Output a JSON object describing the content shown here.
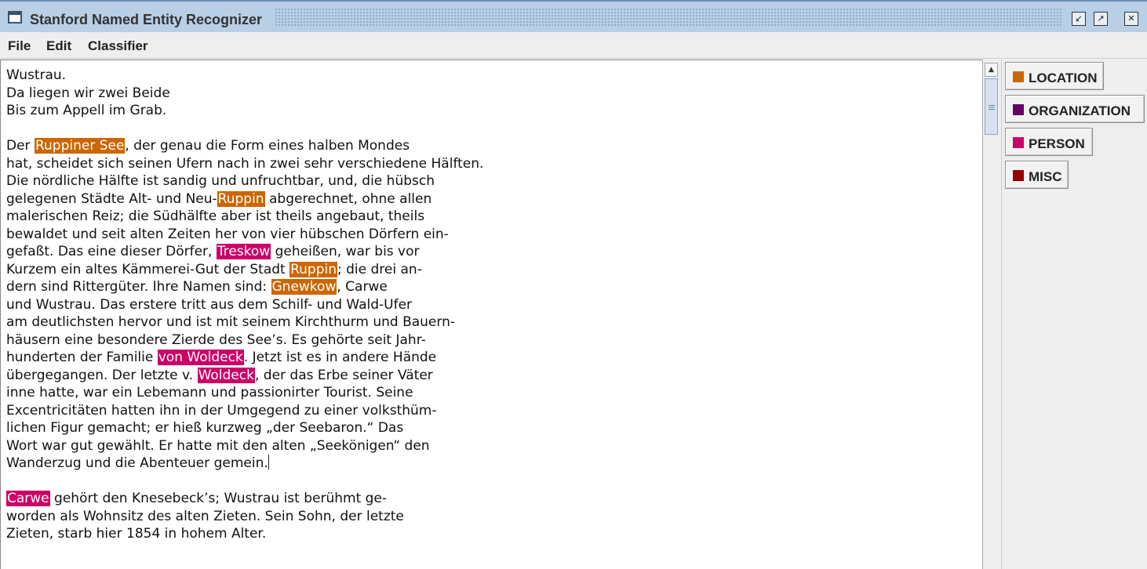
{
  "window": {
    "title": "Stanford Named Entity Recognizer"
  },
  "menu": [
    "File",
    "Edit",
    "Classifier"
  ],
  "colors": {
    "LOCATION": "#cc6600",
    "ORGANIZATION": "#660066",
    "PERSON": "#cc0066",
    "MISC": "#990000"
  },
  "legend": [
    {
      "label": "LOCATION",
      "color": "#cc6600"
    },
    {
      "label": "ORGANIZATION",
      "color": "#660066"
    },
    {
      "label": "PERSON",
      "color": "#cc0066"
    },
    {
      "label": "MISC",
      "color": "#990000"
    }
  ],
  "document": {
    "paragraphs": [
      [
        [
          {
            "t": "Wustrau."
          }
        ],
        [
          {
            "t": "Da liegen wir zwei Beide"
          }
        ],
        [
          {
            "t": "Bis zum Appell im Grab."
          }
        ]
      ],
      [
        [
          {
            "t": "Der "
          },
          {
            "t": "Ruppiner See",
            "e": "LOCATION"
          },
          {
            "t": ", der genau die Form eines halben Mondes"
          }
        ],
        [
          {
            "t": "hat, scheidet sich seinen Ufern nach in zwei sehr verschiedene Hälften."
          }
        ],
        [
          {
            "t": "Die nördliche Hälfte ist sandig und unfruchtbar, und, die hübsch"
          }
        ],
        [
          {
            "t": "gelegenen Städte Alt- und Neu-"
          },
          {
            "t": "Ruppin",
            "e": "LOCATION"
          },
          {
            "t": " abgerechnet, ohne allen"
          }
        ],
        [
          {
            "t": "malerischen Reiz; die Südhälfte aber ist theils angebaut, theils"
          }
        ],
        [
          {
            "t": "bewaldet und seit alten Zeiten her von vier hübschen Dörfern ein-"
          }
        ],
        [
          {
            "t": "gefaßt. Das eine dieser Dörfer, "
          },
          {
            "t": "Treskow",
            "e": "PERSON"
          },
          {
            "t": " geheißen, war bis vor"
          }
        ],
        [
          {
            "t": "Kurzem ein altes Kämmerei-Gut der Stadt "
          },
          {
            "t": "Ruppin",
            "e": "LOCATION"
          },
          {
            "t": "; die drei an-"
          }
        ],
        [
          {
            "t": "dern sind Rittergüter. Ihre Namen sind: "
          },
          {
            "t": "Gnewkow",
            "e": "LOCATION"
          },
          {
            "t": ", Carwe"
          }
        ],
        [
          {
            "t": "und Wustrau. Das erstere tritt aus dem Schilf- und Wald-Ufer"
          }
        ],
        [
          {
            "t": "am deutlichsten hervor und ist mit seinem Kirchthurm und Bauern-"
          }
        ],
        [
          {
            "t": "häusern eine besondere Zierde des See’s. Es gehörte seit Jahr-"
          }
        ],
        [
          {
            "t": "hunderten der Familie "
          },
          {
            "t": "von Woldeck",
            "e": "PERSON"
          },
          {
            "t": ". Jetzt ist es in andere Hände"
          }
        ],
        [
          {
            "t": "übergegangen. Der letzte v. "
          },
          {
            "t": "Woldeck",
            "e": "PERSON"
          },
          {
            "t": ", der das Erbe seiner Väter"
          }
        ],
        [
          {
            "t": "inne hatte, war ein Lebemann und passionirter Tourist. Seine"
          }
        ],
        [
          {
            "t": "Excentricitäten hatten ihn in der Umgegend zu einer volksthüm-"
          }
        ],
        [
          {
            "t": "lichen Figur gemacht; er hieß kurzweg „der Seebaron.“ Das"
          }
        ],
        [
          {
            "t": "Wort war gut gewählt. Er hatte mit den alten „Seekönigen“ den"
          }
        ],
        [
          {
            "t": "Wanderzug und die Abenteuer gemein."
          }
        ]
      ],
      [
        [
          {
            "t": "Carwe",
            "e": "PERSON"
          },
          {
            "t": " gehört den Knesebeck’s; Wustrau ist berühmt ge-"
          }
        ],
        [
          {
            "t": "worden als Wohnsitz des alten Zieten. Sein Sohn, der letzte"
          }
        ],
        [
          {
            "t": "Zieten, starb hier 1854 in hohem Alter."
          }
        ]
      ]
    ]
  }
}
